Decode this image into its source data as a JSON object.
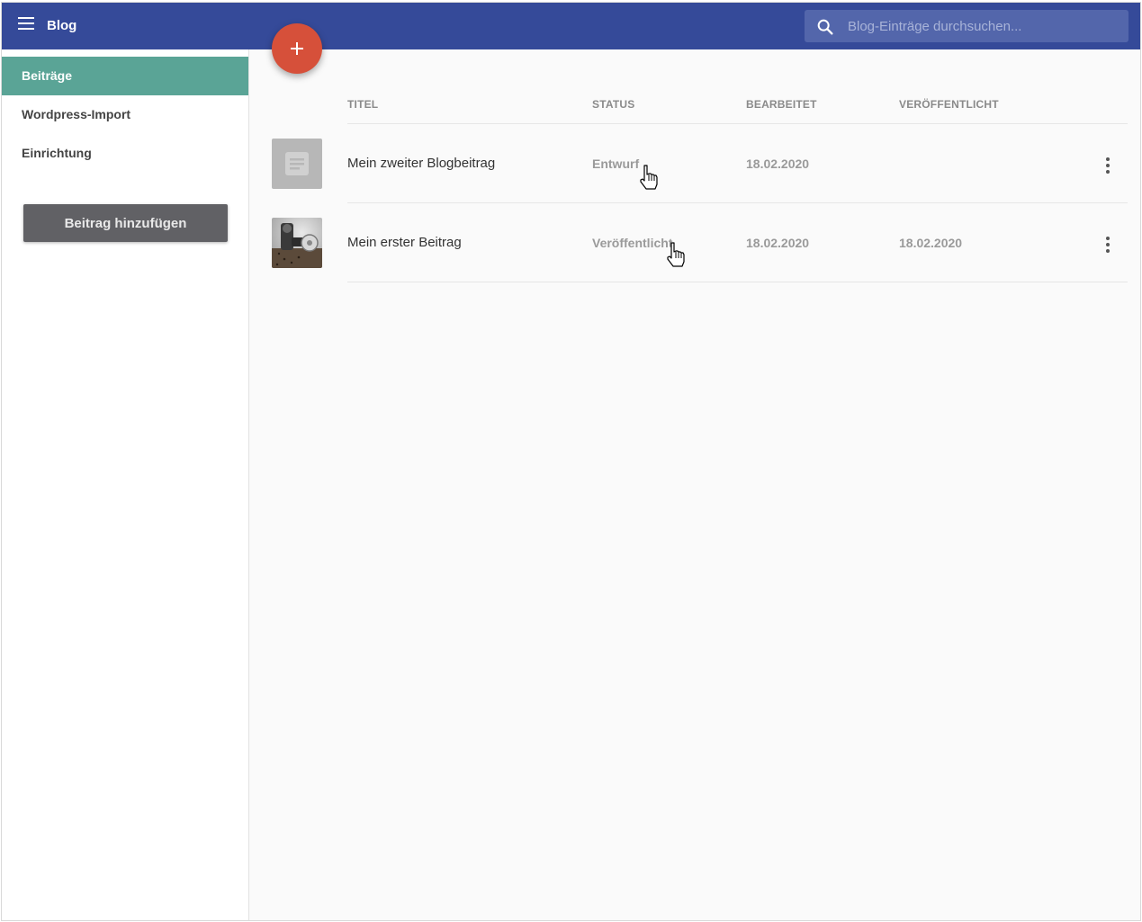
{
  "appbar": {
    "title": "Blog",
    "search_placeholder": "Blog-Einträge durchsuchen..."
  },
  "sidebar": {
    "items": [
      {
        "label": "Beiträge",
        "active": true
      },
      {
        "label": "Wordpress-Import",
        "active": false
      },
      {
        "label": "Einrichtung",
        "active": false
      }
    ],
    "add_button_label": "Beitrag hinzufügen"
  },
  "table": {
    "columns": [
      "TITEL",
      "STATUS",
      "BEARBEITET",
      "VERÖFFENTLICHT"
    ],
    "rows": [
      {
        "title": "Mein zweiter Blogbeitrag",
        "status": "Entwurf",
        "edited": "18.02.2020",
        "published": "",
        "thumbnail": "document-placeholder-icon"
      },
      {
        "title": "Mein erster Beitrag",
        "status": "Veröffentlicht",
        "edited": "18.02.2020",
        "published": "18.02.2020",
        "thumbnail": "photo"
      }
    ]
  },
  "colors": {
    "appbar": "#354a99",
    "active_nav": "#5aa496",
    "fab": "#d6503a",
    "add_button": "#616165"
  }
}
